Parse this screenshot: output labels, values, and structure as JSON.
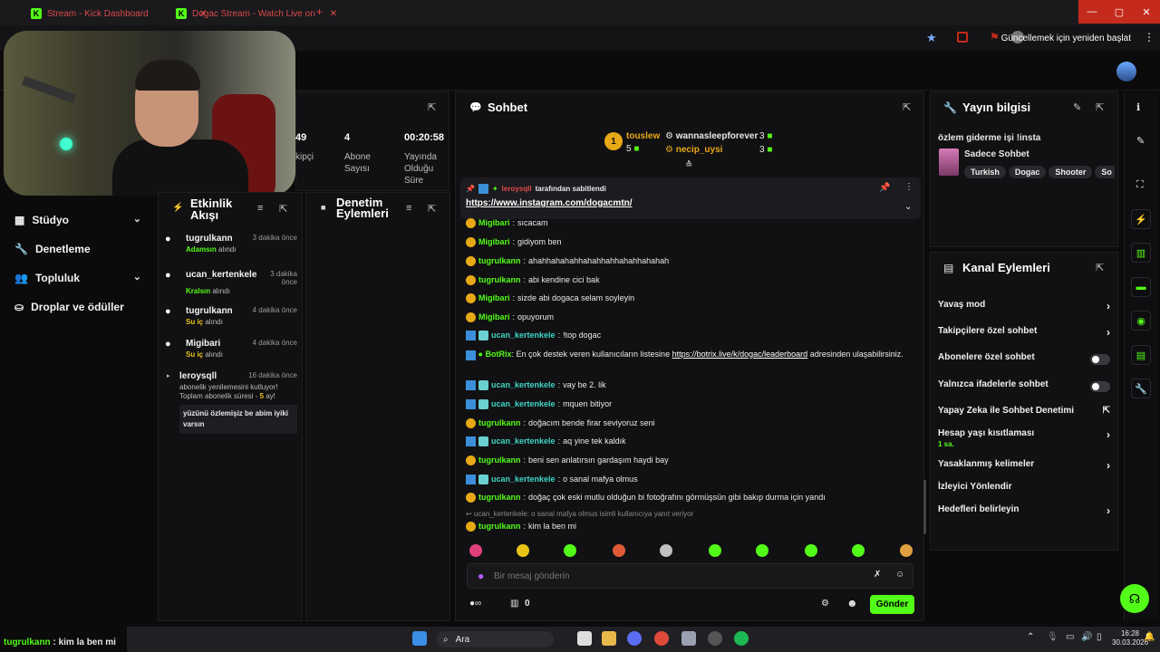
{
  "browser": {
    "tabs": [
      "Stream - Kick Dashboard",
      "Dogac Stream - Watch Live on"
    ],
    "update_button": "Güncellemek için yeniden başlat"
  },
  "sidebar": {
    "items": [
      {
        "label": "Stüdyo"
      },
      {
        "label": "Denetleme"
      },
      {
        "label": "Topluluk"
      },
      {
        "label": "Droplar ve ödüller"
      }
    ]
  },
  "stats": {
    "partial_value": "49",
    "partial_label": "kipçi",
    "subs_value": "4",
    "subs_label_1": "Abone",
    "subs_label_2": "Sayısı",
    "uptime_value": "00:20:58",
    "uptime_label_1": "Yayında",
    "uptime_label_2": "Olduğu",
    "uptime_label_3": "Süre"
  },
  "activity": {
    "title_1": "Etkinlik",
    "title_2": "Akışı",
    "items": [
      {
        "user": "tugrulkann",
        "time": "3 dakika önce",
        "gift": "Adamsın",
        "suffix": "alındı"
      },
      {
        "user": "ucan_kertenkele",
        "time": "3 dakika önce",
        "gift": "Kralsın",
        "suffix": "alındı"
      },
      {
        "user": "tugrulkann",
        "time": "4 dakika önce",
        "gift": "Su iç",
        "suffix": "alındı"
      },
      {
        "user": "Migibari",
        "time": "4 dakika önce",
        "gift": "Su iç",
        "suffix": "alındı"
      }
    ],
    "resub": {
      "user": "leroysqll",
      "time": "16 dakika önce",
      "line1": "abonelik yenilemesini kutluyor!",
      "line2": "Toplam abonelik süresi -",
      "months": "5",
      "months_suffix": "ay!",
      "message": "yüzünü özlemişiz be abim iyiki varsın"
    }
  },
  "moderation": {
    "title_1": "Denetim",
    "title_2": "Eylemleri"
  },
  "chat": {
    "title": "Sohbet",
    "leaders": [
      {
        "name": "touslew",
        "count": "5"
      },
      {
        "name": "wannasleepforever",
        "count": "3"
      },
      {
        "name": "necip_uysi",
        "count": "3"
      }
    ],
    "pinned": {
      "by": "leroysqll",
      "suffix": "tarafından sabitlendi",
      "link": "https://www.instagram.com/dogacmtn/"
    },
    "messages": [
      {
        "user": "Migibari",
        "color": "#53fc18",
        "badge": "gold",
        "text": "sıcacam"
      },
      {
        "user": "Migibari",
        "color": "#53fc18",
        "badge": "gold",
        "text": "gidiyom ben"
      },
      {
        "user": "tugrulkann",
        "color": "#53fc18",
        "badge": "gold",
        "text": "ahahhahahahhahahhahhahahhahahah"
      },
      {
        "user": "tugrulkann",
        "color": "#53fc18",
        "badge": "gold",
        "text": "abi kendine cici bak"
      },
      {
        "user": "Migibari",
        "color": "#53fc18",
        "badge": "gold",
        "text": "sizde abi dogaca selam soyleyin"
      },
      {
        "user": "Migibari",
        "color": "#53fc18",
        "badge": "gold",
        "text": "opuyorum"
      },
      {
        "user": "ucan_kertenkele",
        "color": "#3fd6c6",
        "badge": "blue",
        "text": "!top dogac"
      },
      {
        "user": "ucan_kertenkele",
        "color": "#3fd6c6",
        "badge": "blue",
        "text": "vay be 2. lik"
      },
      {
        "user": "ucan_kertenkele",
        "color": "#3fd6c6",
        "badge": "blue",
        "text": "mquen bitiyor"
      },
      {
        "user": "tugrulkann",
        "color": "#53fc18",
        "badge": "gold",
        "text": "doğacım bende firar seviyoruz seni"
      },
      {
        "user": "ucan_kertenkele",
        "color": "#3fd6c6",
        "badge": "blue",
        "text": "aq yine tek kaldık"
      },
      {
        "user": "tugrulkann",
        "color": "#53fc18",
        "badge": "gold",
        "text": "beni sen anlatırsın gardaşım haydi bay"
      },
      {
        "user": "ucan_kertenkele",
        "color": "#3fd6c6",
        "badge": "blue",
        "text": "o sanal mafya olmus"
      },
      {
        "user": "tugrulkann",
        "color": "#53fc18",
        "badge": "gold",
        "text": "doğaç çok eski mutlu olduğun bi fotoğrafını görmüşsün gibi bakıp durma için yandı"
      }
    ],
    "botrix": {
      "user": "BotRix",
      "text1": "En çok destek veren kullanıcıların listesine",
      "link": "https://botrix.live/k/dogac/leaderboard",
      "text2": "adresinden ulaşabilirsiniz."
    },
    "reply_hint": "ucan_kertenkele: o sanal mafya olmus isimli kullanıcıya yanıt veriyor",
    "last": {
      "user": "tugrulkann",
      "text": "kim la ben mi"
    },
    "input_placeholder": "Bir mesaj gönderin",
    "counter": "0",
    "send_label": "Gönder"
  },
  "stream_info": {
    "title": "Yayın bilgisi",
    "stream_title": "özlem giderme işi !insta",
    "category": "Sadece Sohbet",
    "tags": [
      "Turkish",
      "Dogac",
      "Shooter",
      "So"
    ]
  },
  "channel_actions": {
    "title": "Kanal Eylemleri",
    "rows": [
      {
        "label": "Yavaş mod",
        "kind": "chev"
      },
      {
        "label": "Takipçilere özel sohbet",
        "kind": "chev"
      },
      {
        "label": "Abonelere özel sohbet",
        "kind": "toggle"
      },
      {
        "label": "Yalnızca ifadelerle sohbet",
        "kind": "toggle"
      },
      {
        "label": "Yapay Zeka ile Sohbet Denetimi",
        "kind": "ext"
      },
      {
        "label": "Hesap yaşı kısıtlaması",
        "kind": "chev"
      },
      {
        "label": "Yasaklanmış kelimeler",
        "kind": "chev"
      },
      {
        "label": "İzleyici Yönlendir",
        "kind": "none"
      },
      {
        "label": "Hedefleri belirleyin",
        "kind": "chev"
      }
    ],
    "account_age_value": "1 sa."
  },
  "overlay": {
    "user": "tugrulkann",
    "text": "kim la ben mi"
  },
  "taskbar": {
    "search": "Ara",
    "time": "16:28",
    "date": "30.03.2026"
  },
  "colors": {
    "accent": "#53fc18",
    "background": "#0b0b0c",
    "panel": "#111113"
  }
}
